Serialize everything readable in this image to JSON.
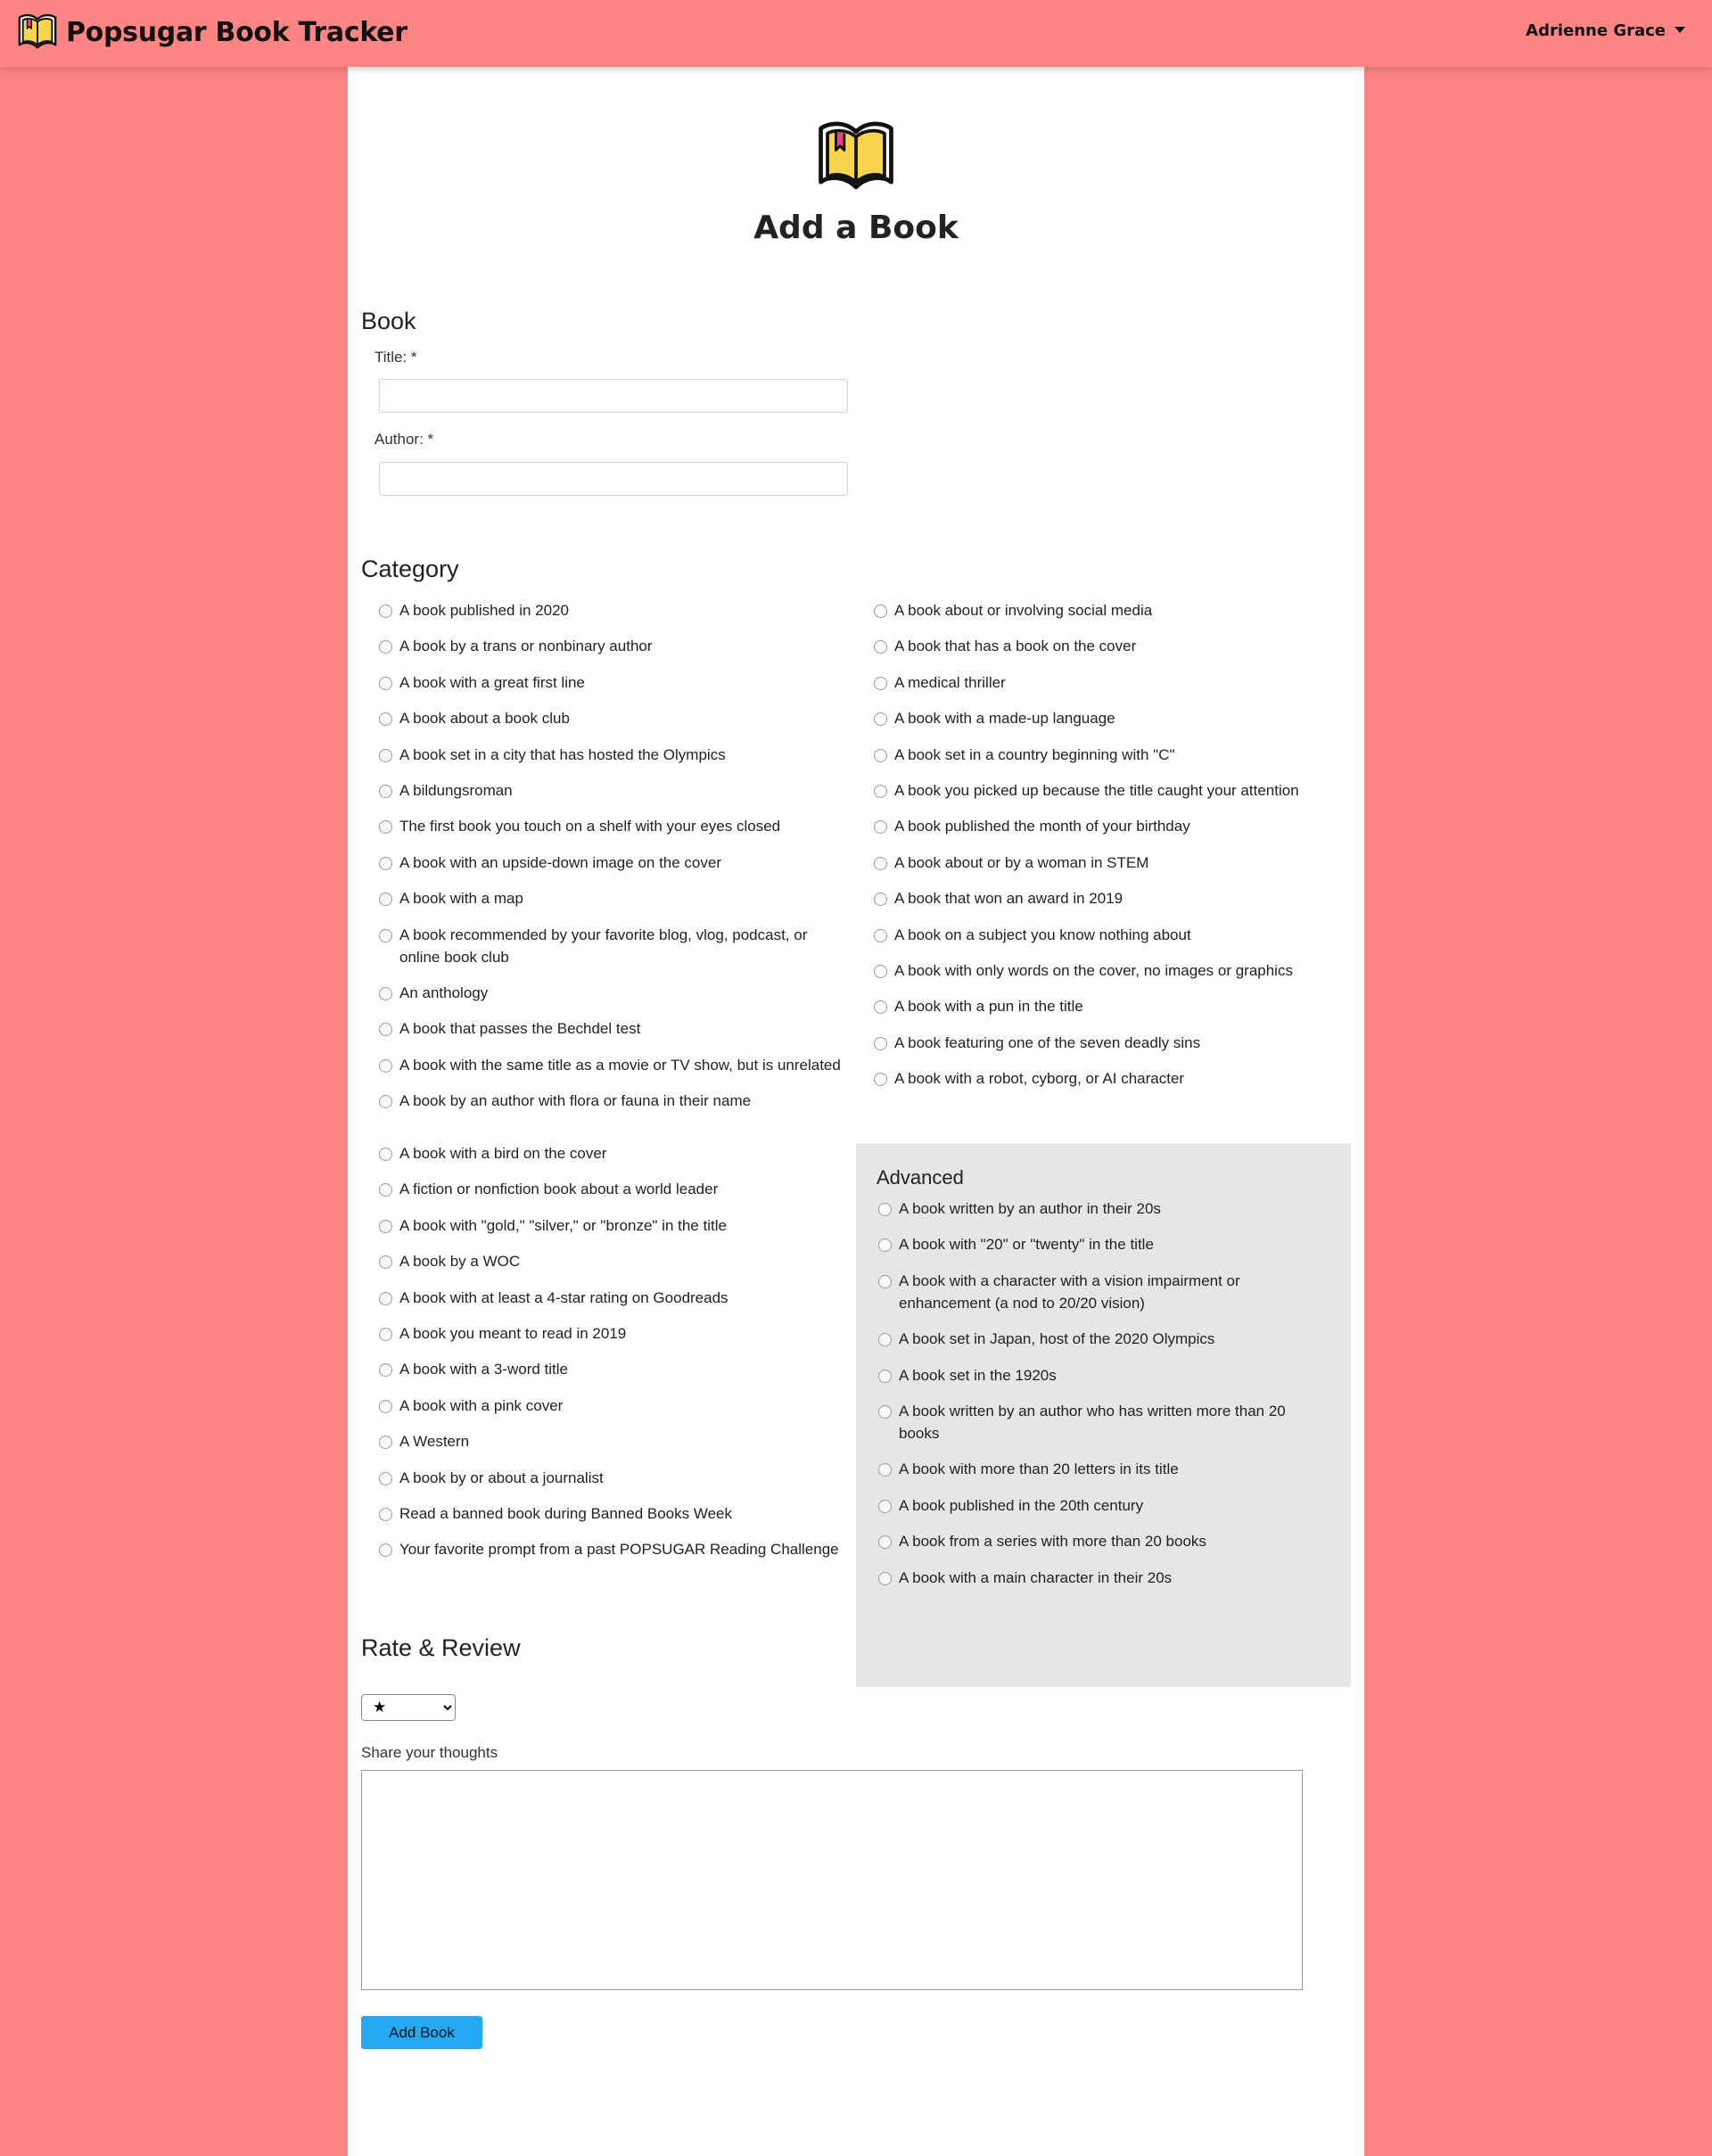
{
  "app": {
    "brand_name": "Popsugar Book Tracker",
    "user_name": "Adrienne Grace"
  },
  "colors": {
    "background": "#ff8585",
    "panel": "#ffffff",
    "advanced_panel": "#e6e6e6",
    "button": "#23a9f2",
    "logo_yellow": "#f8d34c",
    "logo_bookmark": "#e8408a"
  },
  "icons": {
    "brand_logo": "book-icon",
    "user_menu_caret": "caret-down-icon"
  },
  "page": {
    "title": "Add a Book"
  },
  "book_section": {
    "heading": "Book",
    "title_label": "Title: *",
    "title_value": "",
    "author_label": "Author: *",
    "author_value": ""
  },
  "category_section": {
    "heading": "Category",
    "column1": [
      "A book published in 2020",
      "A book by a trans or nonbinary author",
      "A book with a great first line",
      "A book about a book club",
      "A book set in a city that has hosted the Olympics",
      "A bildungsroman",
      "The first book you touch on a shelf with your eyes closed",
      "A book with an upside-down image on the cover",
      "A book with a map",
      "A book recommended by your favorite blog, vlog, podcast, or online book club",
      "An anthology",
      "A book that passes the Bechdel test",
      "A book with the same title as a movie or TV show, but is unrelated",
      "A book by an author with flora or fauna in their name"
    ],
    "column2": [
      "A book about or involving social media",
      "A book that has a book on the cover",
      "A medical thriller",
      "A book with a made-up language",
      "A book set in a country beginning with \"C\"",
      "A book you picked up because the title caught your attention",
      "A book published the month of your birthday",
      "A book about or by a woman in STEM",
      "A book that won an award in 2019",
      "A book on a subject you know nothing about",
      "A book with only words on the cover, no images or graphics",
      "A book with a pun in the title",
      "A book featuring one of the seven deadly sins",
      "A book with a robot, cyborg, or AI character"
    ],
    "column3": [
      "A book with a bird on the cover",
      "A fiction or nonfiction book about a world leader",
      "A book with \"gold,\" \"silver,\" or \"bronze\" in the title",
      "A book by a WOC",
      "A book with at least a 4-star rating on Goodreads",
      "A book you meant to read in 2019",
      "A book with a 3-word title",
      "A book with a pink cover",
      "A Western",
      "A book by or about a journalist",
      "Read a banned book during Banned Books Week",
      "Your favorite prompt from a past POPSUGAR Reading Challenge"
    ],
    "advanced": {
      "heading": "Advanced",
      "items": [
        "A book written by an author in their 20s",
        "A book with \"20\" or \"twenty\" in the title",
        "A book with a character with a vision impairment or enhancement (a nod to 20/20 vision)",
        "A book set in Japan, host of the 2020 Olympics",
        "A book set in the 1920s",
        "A book written by an author who has written more than 20 books",
        "A book with more than 20 letters in its title",
        "A book published in the 20th century",
        "A book from a series with more than 20 books",
        "A book with a main character in their 20s"
      ]
    }
  },
  "review_section": {
    "heading": "Rate & Review",
    "rating_value": "★",
    "thoughts_label": "Share your thoughts",
    "thoughts_value": "",
    "submit_label": "Add Book"
  }
}
